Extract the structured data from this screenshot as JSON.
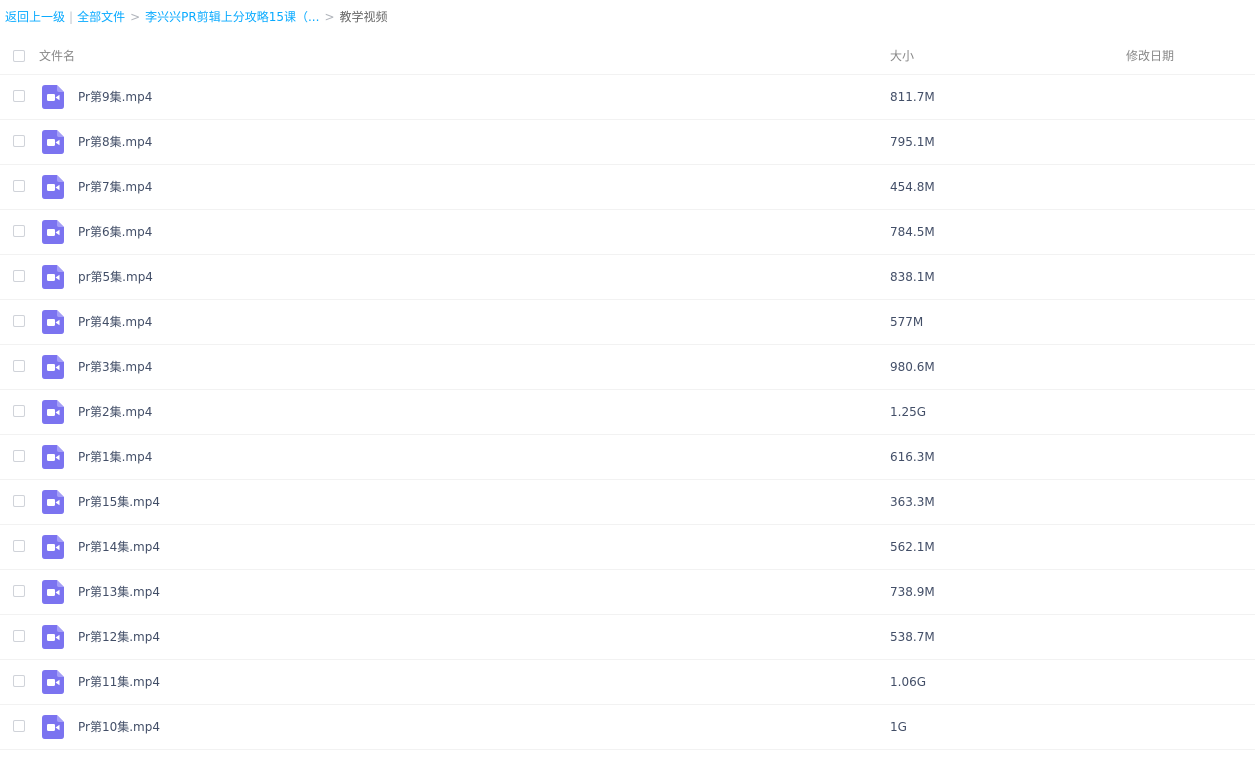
{
  "breadcrumb": {
    "back": "返回上一级",
    "all_files": "全部文件",
    "parent": "李兴兴PR剪辑上分攻略15课（...",
    "current": "教学视频",
    "separator": ">",
    "pipe": "|"
  },
  "header": {
    "name": "文件名",
    "size": "大小",
    "date": "修改日期"
  },
  "colors": {
    "link": "#09aaff",
    "video_icon": "#7b73f0"
  },
  "files": [
    {
      "name": "Pr第9集.mp4",
      "size": "811.7M",
      "date": "",
      "icon": "video-file-icon"
    },
    {
      "name": "Pr第8集.mp4",
      "size": "795.1M",
      "date": "",
      "icon": "video-file-icon"
    },
    {
      "name": "Pr第7集.mp4",
      "size": "454.8M",
      "date": "",
      "icon": "video-file-icon"
    },
    {
      "name": "Pr第6集.mp4",
      "size": "784.5M",
      "date": "",
      "icon": "video-file-icon"
    },
    {
      "name": "pr第5集.mp4",
      "size": "838.1M",
      "date": "",
      "icon": "video-file-icon"
    },
    {
      "name": "Pr第4集.mp4",
      "size": "577M",
      "date": "",
      "icon": "video-file-icon"
    },
    {
      "name": "Pr第3集.mp4",
      "size": "980.6M",
      "date": "",
      "icon": "video-file-icon"
    },
    {
      "name": "Pr第2集.mp4",
      "size": "1.25G",
      "date": "",
      "icon": "video-file-icon"
    },
    {
      "name": "Pr第1集.mp4",
      "size": "616.3M",
      "date": "",
      "icon": "video-file-icon"
    },
    {
      "name": "Pr第15集.mp4",
      "size": "363.3M",
      "date": "",
      "icon": "video-file-icon"
    },
    {
      "name": "Pr第14集.mp4",
      "size": "562.1M",
      "date": "",
      "icon": "video-file-icon"
    },
    {
      "name": "Pr第13集.mp4",
      "size": "738.9M",
      "date": "",
      "icon": "video-file-icon"
    },
    {
      "name": "Pr第12集.mp4",
      "size": "538.7M",
      "date": "",
      "icon": "video-file-icon"
    },
    {
      "name": "Pr第11集.mp4",
      "size": "1.06G",
      "date": "",
      "icon": "video-file-icon"
    },
    {
      "name": "Pr第10集.mp4",
      "size": "1G",
      "date": "",
      "icon": "video-file-icon"
    }
  ]
}
